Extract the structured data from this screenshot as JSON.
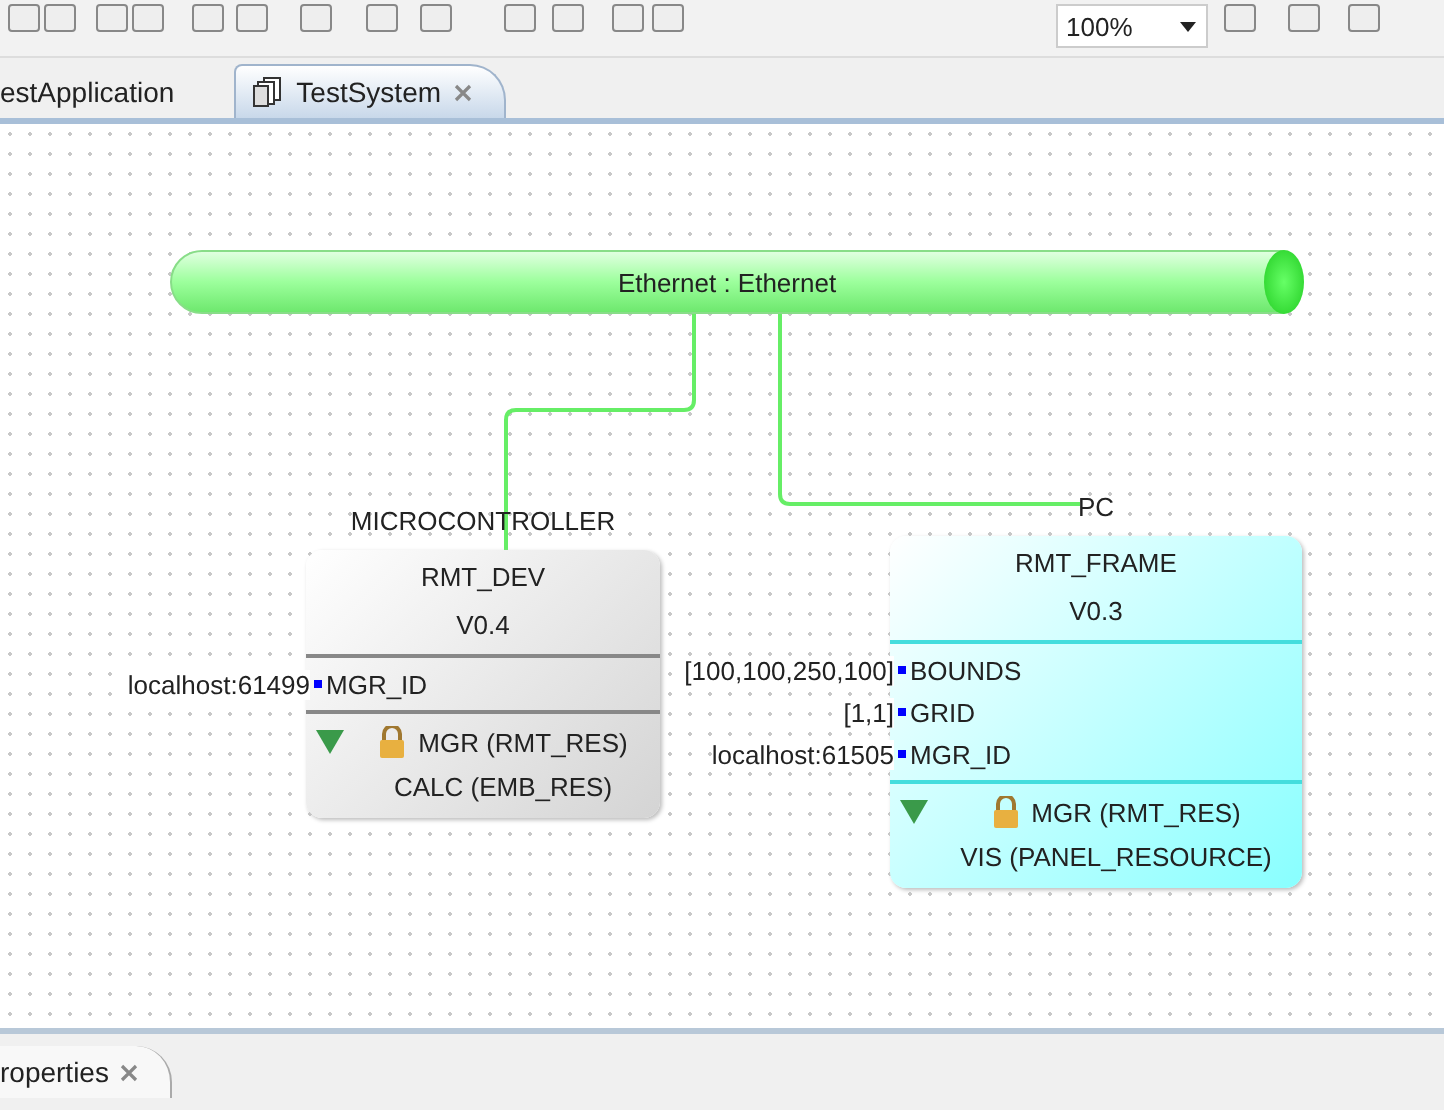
{
  "toolbar": {
    "zoom": "100%"
  },
  "editor_tabs": [
    {
      "label": "estApplication",
      "selected": false
    },
    {
      "label": "TestSystem",
      "selected": true
    }
  ],
  "segment": {
    "name": "Ethernet : Ethernet"
  },
  "devices": [
    {
      "type_label": "MICROCONTROLLER",
      "name": "RMT_DEV",
      "version": "V0.4",
      "color": "#d4d4d4",
      "params": [
        {
          "value": "localhost:61499",
          "name": "MGR_ID"
        }
      ],
      "resources": [
        {
          "name": "MGR (RMT_RES)",
          "locked": true
        },
        {
          "name": "CALC (EMB_RES)",
          "locked": false
        }
      ]
    },
    {
      "type_label": "PC",
      "name": "RMT_FRAME",
      "version": "V0.3",
      "color": "#88ffff",
      "params": [
        {
          "value": "[100,100,250,100]",
          "name": "BOUNDS"
        },
        {
          "value": "[1,1]",
          "name": "GRID"
        },
        {
          "value": "localhost:61505",
          "name": "MGR_ID"
        }
      ],
      "resources": [
        {
          "name": "MGR (RMT_RES)",
          "locked": true
        },
        {
          "name": "VIS (PANEL_RESOURCE)",
          "locked": false
        }
      ]
    }
  ],
  "bottom_tabs": [
    {
      "label": "roperties",
      "selected": true
    }
  ]
}
